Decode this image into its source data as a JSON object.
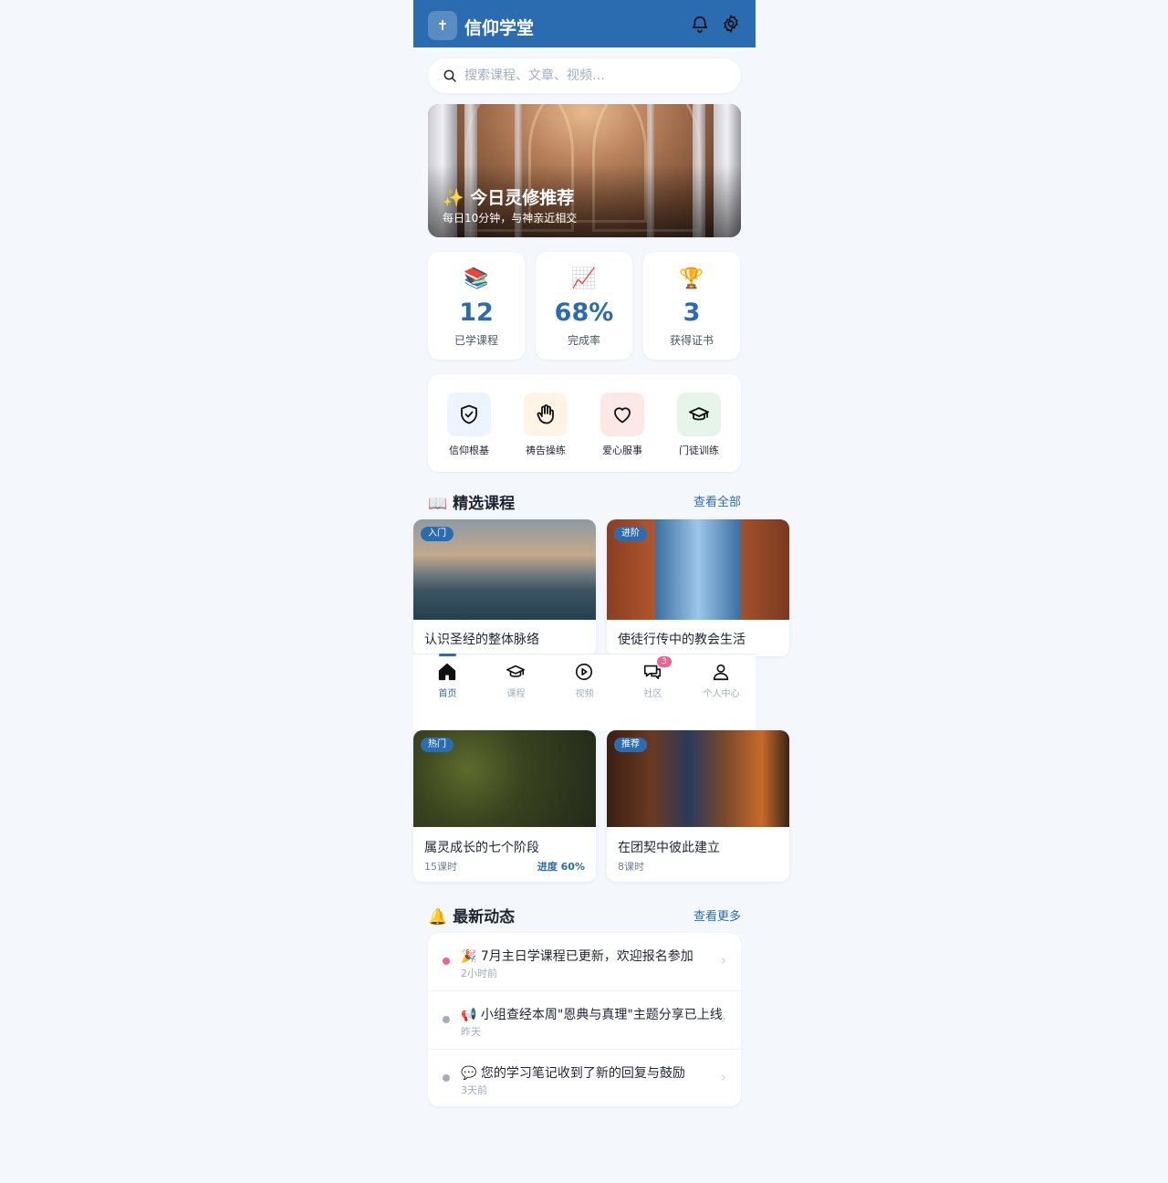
{
  "header": {
    "logo_glyph": "✝",
    "title": "信仰学堂",
    "bell_icon": "bell-icon",
    "settings_icon": "gear-icon"
  },
  "search": {
    "placeholder": "搜索课程、文章、视频…",
    "icon": "search-icon"
  },
  "banner": {
    "title": "✨ 今日灵修推荐",
    "subtitle": "每日10分钟，与神亲近相交"
  },
  "stats": [
    {
      "icon": "📚",
      "value": "12",
      "label": "已学课程"
    },
    {
      "icon": "📈",
      "value": "68%",
      "label": "完成率"
    },
    {
      "icon": "🏆",
      "value": "3",
      "label": "获得证书"
    }
  ],
  "quick_actions": [
    {
      "icon": "shield-check-icon",
      "label": "信仰根基",
      "bg": "#ebf4ff"
    },
    {
      "icon": "hand-icon",
      "label": "祷告操练",
      "bg": "#fff4e5"
    },
    {
      "icon": "heart-icon",
      "label": "爱心服事",
      "bg": "#fde8e8"
    },
    {
      "icon": "graduation-cap-icon",
      "label": "门徒训练",
      "bg": "#e6f4ea"
    }
  ],
  "featured": {
    "title": "📖 精选课程",
    "more": "查看全部",
    "cards": [
      {
        "tag": "入门",
        "title": "认识圣经的整体脉络",
        "image": "ocean-sunset-photo"
      },
      {
        "tag": "进阶",
        "title": "使徒行传中的教会生活",
        "image": "city-bridge-photo"
      },
      {
        "tag": "热门",
        "title": "属灵成长的七个阶段",
        "image": "forest-aerial-photo",
        "meta": "15课时",
        "progress": "进度 60%"
      },
      {
        "tag": "推荐",
        "title": "在团契中彼此建立",
        "image": "cafe-gathering-photo",
        "meta": "8课时"
      }
    ]
  },
  "bottom_nav": [
    {
      "icon": "home-icon",
      "label": "首页",
      "active": true
    },
    {
      "icon": "graduation-cap-icon",
      "label": "课程"
    },
    {
      "icon": "play-icon",
      "label": "视频"
    },
    {
      "icon": "chat-icon",
      "label": "社区",
      "badge": "3"
    },
    {
      "icon": "user-icon",
      "label": "个人中心"
    }
  ],
  "activity": {
    "title": "🔔 最新动态",
    "more": "查看更多",
    "items": [
      {
        "text": "🎉 7月主日学课程已更新，欢迎报名参加",
        "time": "2小时前",
        "dot": "#f06292"
      },
      {
        "text": "📢 小组查经本周\"恩典与真理\"主题分享已上线",
        "time": "昨天",
        "dot": "#a0aec0"
      },
      {
        "text": "💬 您的学习笔记收到了新的回复与鼓励",
        "time": "3天前",
        "dot": "#a0aec0"
      }
    ]
  },
  "colors": {
    "primary": "#2b6cb0",
    "background": "#f4f8fc",
    "badge": "#f06292"
  }
}
